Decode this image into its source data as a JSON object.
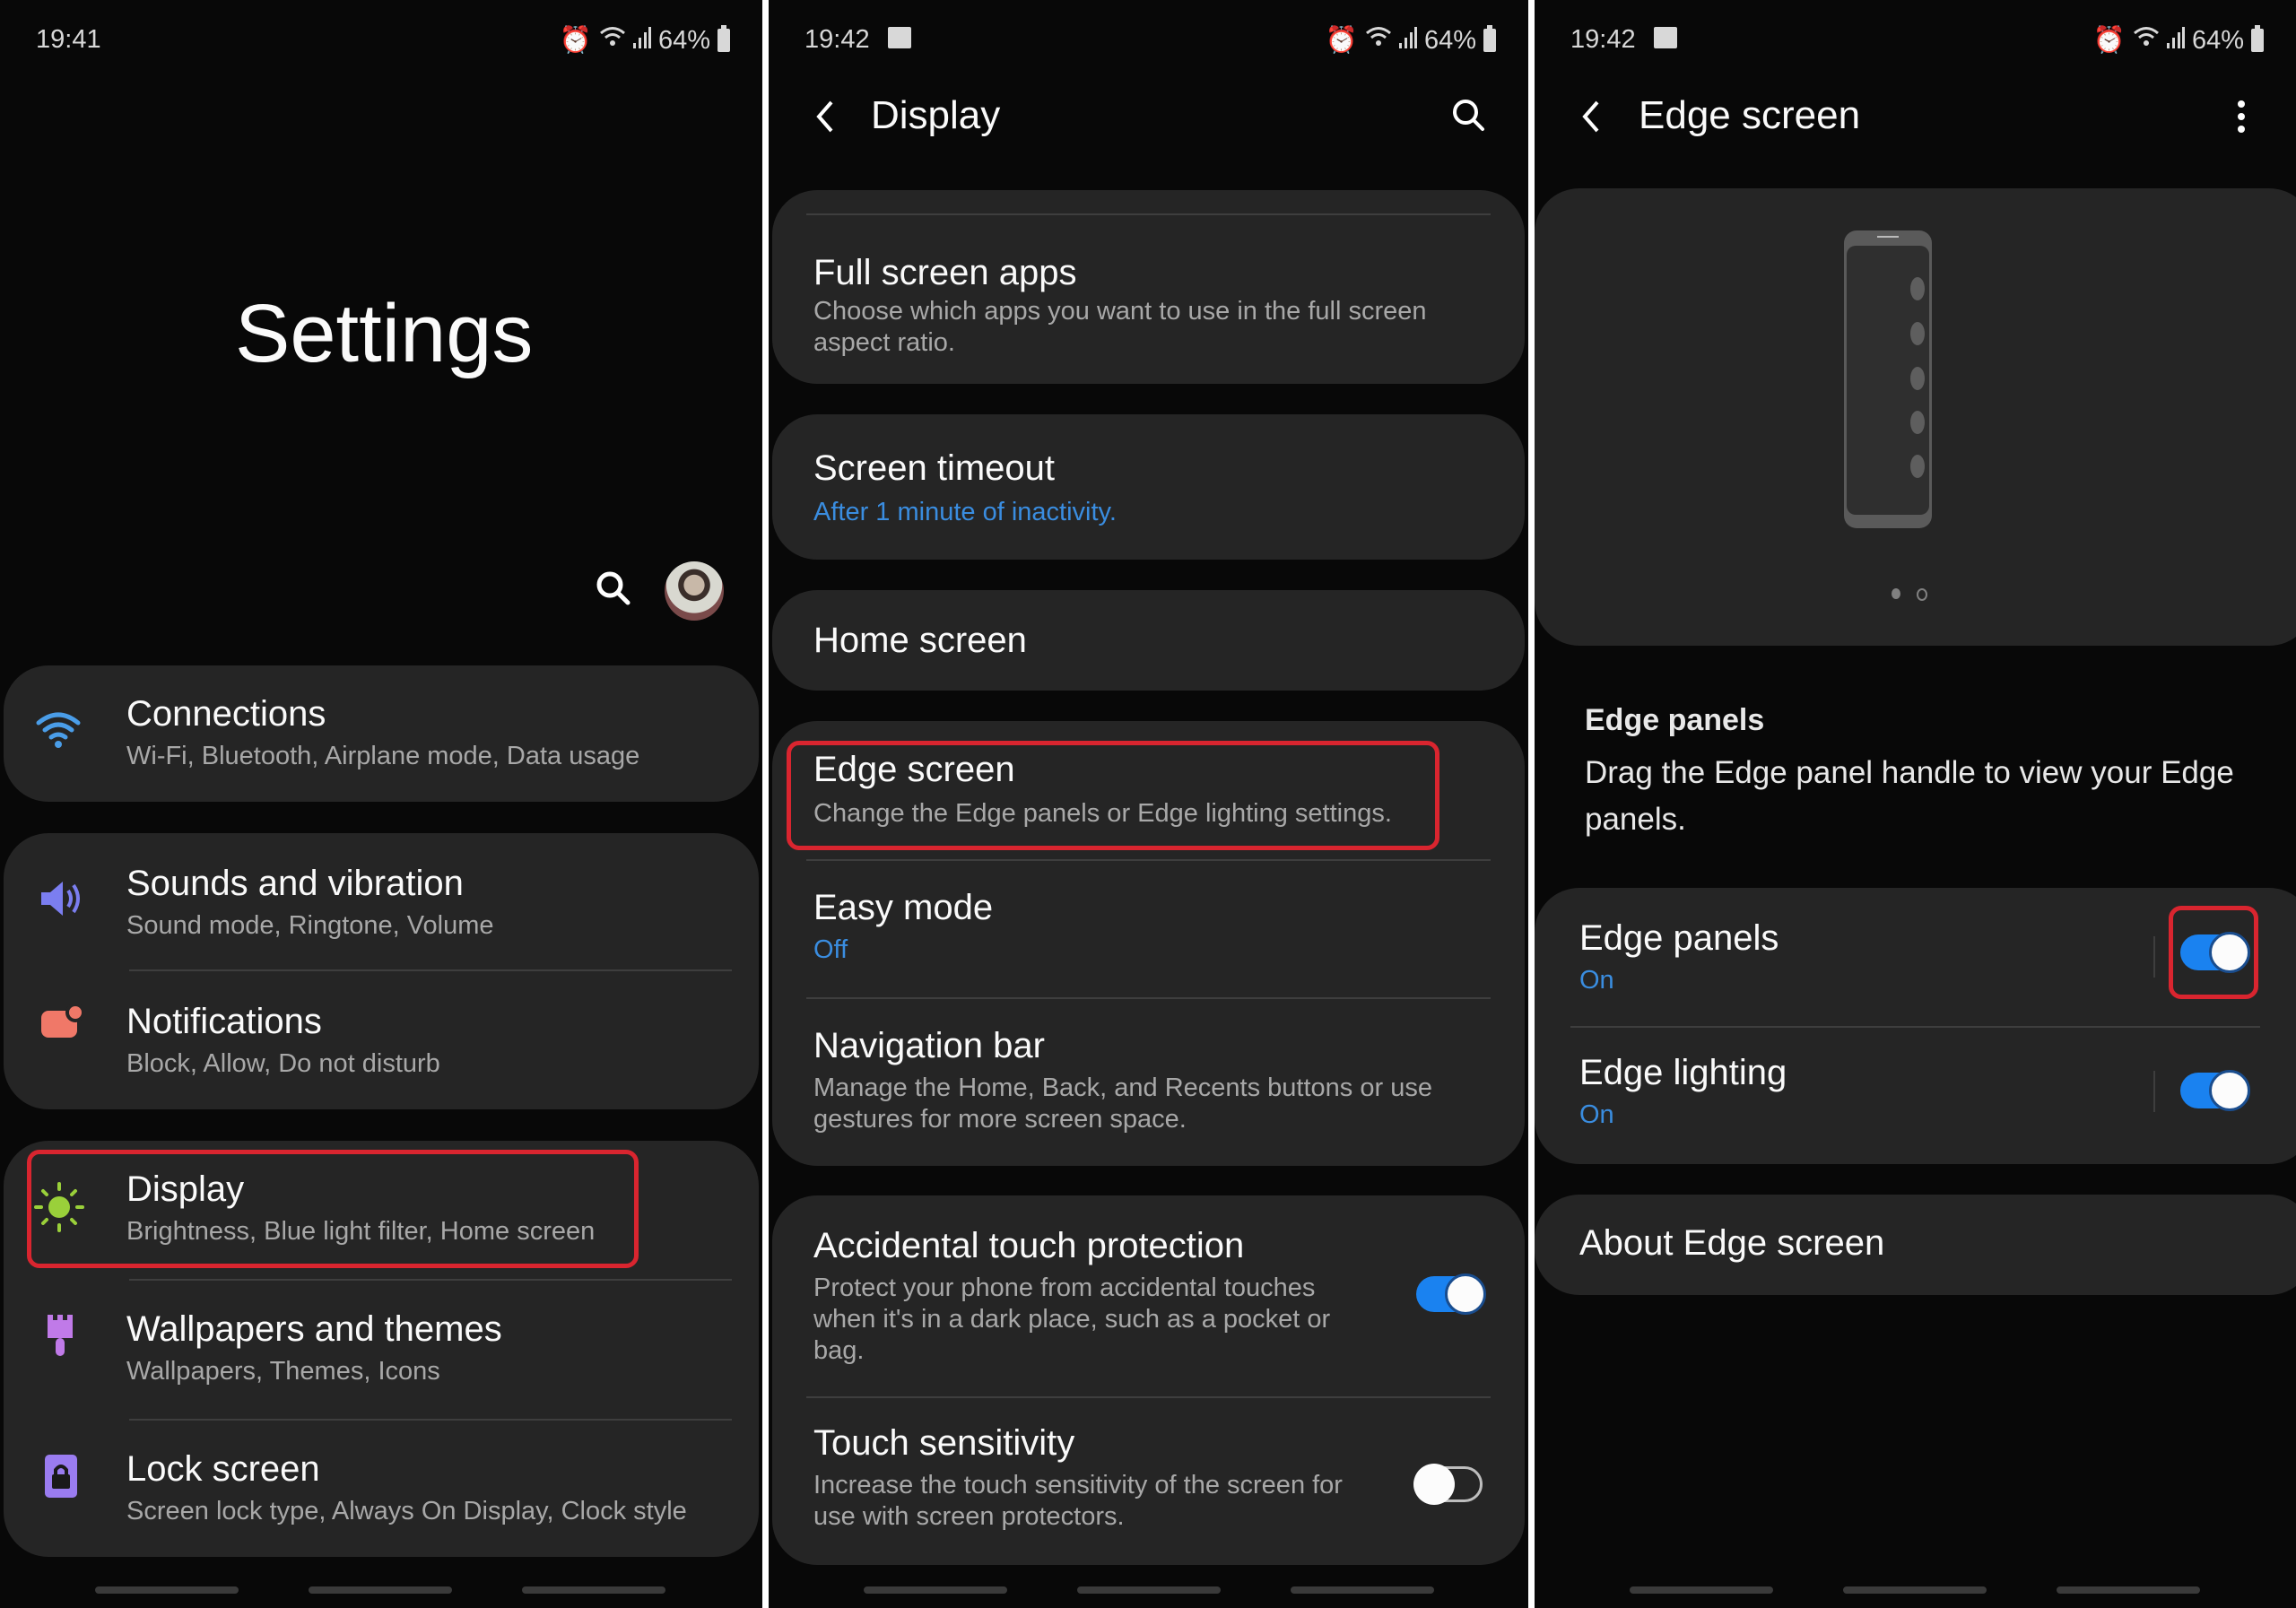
{
  "status_bars": [
    {
      "time": "19:41",
      "battery": "64%",
      "icons": [
        "alarm-icon",
        "wifi-icon",
        "signal-icon",
        "battery-icon"
      ]
    },
    {
      "time": "19:42",
      "battery": "64%",
      "icons": [
        "gallery-icon",
        "alarm-icon",
        "wifi-icon",
        "signal-icon",
        "battery-icon"
      ]
    },
    {
      "time": "19:42",
      "battery": "64%",
      "icons": [
        "gallery-icon",
        "alarm-icon",
        "wifi-icon",
        "signal-icon",
        "battery-icon"
      ]
    }
  ],
  "settings_screen": {
    "title": "Settings",
    "search_icon": "search-icon",
    "avatar": "user-avatar",
    "items": [
      {
        "title": "Connections",
        "subtitle": "Wi-Fi, Bluetooth, Airplane mode, Data usage",
        "icon": "wifi-icon",
        "icon_color": "#4a9de8"
      },
      {
        "title": "Sounds and vibration",
        "subtitle": "Sound mode, Ringtone, Volume",
        "icon": "speaker-icon",
        "icon_color": "#7b7ef0"
      },
      {
        "title": "Notifications",
        "subtitle": "Block, Allow, Do not disturb",
        "icon": "notification-icon",
        "icon_color": "#f07868"
      },
      {
        "title": "Display",
        "subtitle": "Brightness, Blue light filter, Home screen",
        "icon": "sun-icon",
        "icon_color": "#9ad03a",
        "highlighted": true
      },
      {
        "title": "Wallpapers and themes",
        "subtitle": "Wallpapers, Themes, Icons",
        "icon": "paintbrush-icon",
        "icon_color": "#c07ae8"
      },
      {
        "title": "Lock screen",
        "subtitle": "Screen lock type, Always On Display, Clock style",
        "icon": "lock-icon",
        "icon_color": "#9a7cf0"
      }
    ]
  },
  "display_screen": {
    "title": "Display",
    "back_icon": "back-arrow-icon",
    "search_icon": "search-icon",
    "items": [
      {
        "title": "Full screen apps",
        "subtitle": "Choose which apps you want to use in the full screen aspect ratio."
      },
      {
        "title": "Screen timeout",
        "subtitle": "After 1 minute of inactivity.",
        "subtitle_style": "blue"
      },
      {
        "title": "Home screen"
      },
      {
        "title": "Edge screen",
        "subtitle": "Change the Edge panels or Edge lighting settings.",
        "highlighted": true
      },
      {
        "title": "Easy mode",
        "subtitle": "Off",
        "subtitle_style": "blue"
      },
      {
        "title": "Navigation bar",
        "subtitle": "Manage the Home, Back, and Recents buttons or use gestures for more screen space."
      },
      {
        "title": "Accidental touch protection",
        "subtitle": "Protect your phone from accidental touches when it's in a dark place, such as a pocket or bag.",
        "toggle": true
      },
      {
        "title": "Touch sensitivity",
        "subtitle": "Increase the touch sensitivity of the screen for use with screen protectors.",
        "toggle": false
      }
    ]
  },
  "edge_screen": {
    "title": "Edge screen",
    "back_icon": "back-arrow-icon",
    "more_icon": "more-options-icon",
    "illustration": {
      "page_indicator": {
        "current": 1,
        "total": 2
      }
    },
    "section_heading": "Edge panels",
    "section_description": "Drag the Edge panel handle to view your Edge panels.",
    "items": [
      {
        "title": "Edge panels",
        "status": "On",
        "toggle": true,
        "highlighted": true
      },
      {
        "title": "Edge lighting",
        "status": "On",
        "toggle": true
      }
    ],
    "about": "About Edge screen"
  },
  "colors": {
    "accent": "#1a82f0",
    "link_blue": "#3a8de0",
    "highlight_red": "#d9252f",
    "card_bg": "#252525",
    "screen_bg": "#080808"
  }
}
